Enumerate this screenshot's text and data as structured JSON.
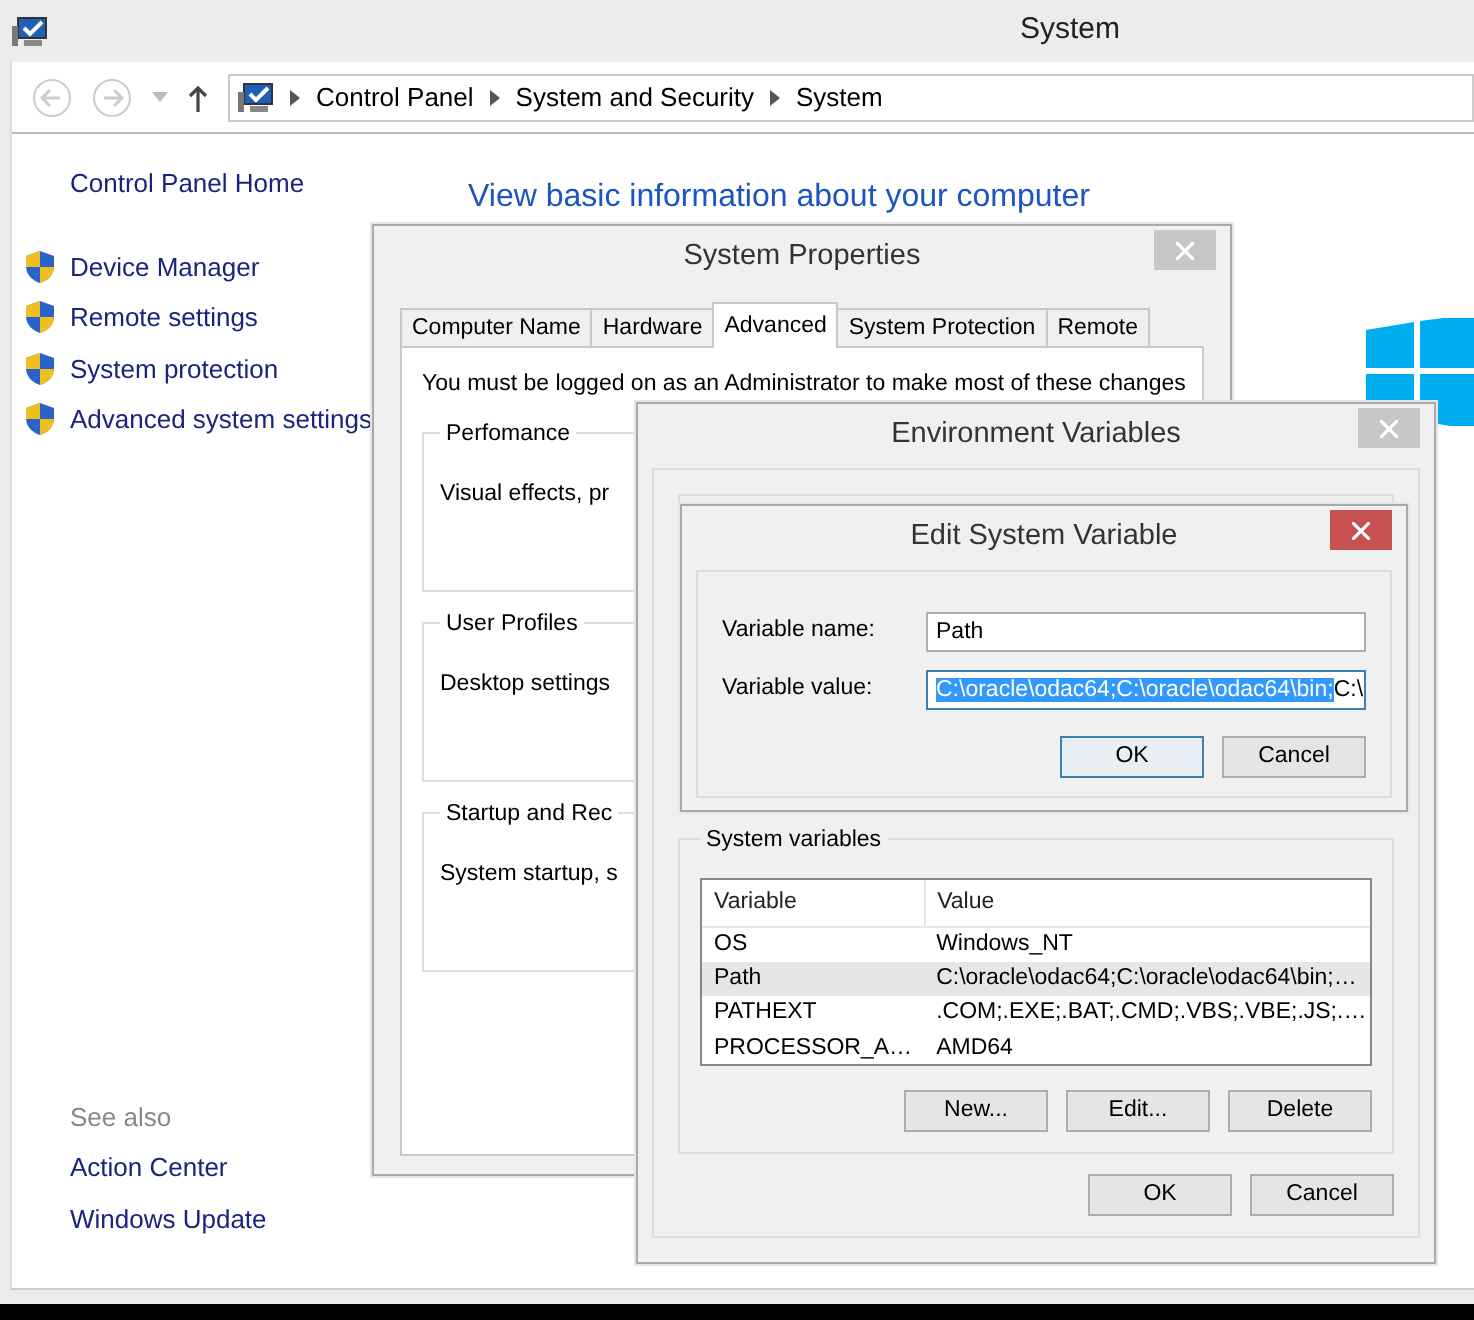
{
  "window": {
    "title": "System"
  },
  "address_bar": {
    "breadcrumbs": [
      "Control Panel",
      "System and Security",
      "System"
    ]
  },
  "sidebar": {
    "home": "Control Panel Home",
    "items": [
      "Device Manager",
      "Remote settings",
      "System protection",
      "Advanced system settings"
    ],
    "see_also": {
      "heading": "See also",
      "links": [
        "Action Center",
        "Windows Update"
      ]
    }
  },
  "main": {
    "heading": "View basic information about your computer"
  },
  "system_properties": {
    "title": "System Properties",
    "tabs": [
      {
        "label": "Computer Name",
        "selected": false
      },
      {
        "label": "Hardware",
        "selected": false
      },
      {
        "label": "Advanced",
        "selected": true
      },
      {
        "label": "System Protection",
        "selected": false
      },
      {
        "label": "Remote",
        "selected": false
      }
    ],
    "notice": "You must be logged on as an Administrator to make most of these changes",
    "groups": [
      {
        "title": "Perfomance",
        "text": "Visual effects, pr"
      },
      {
        "title": "User Profiles",
        "text": "Desktop settings"
      },
      {
        "title": "Startup and Rec",
        "text": "System startup, s"
      }
    ]
  },
  "environment_variables": {
    "title": "Environment Variables",
    "system_variables": {
      "title": "System variables",
      "columns": [
        "Variable",
        "Value"
      ],
      "rows": [
        {
          "variable": "OS",
          "value": "Windows_NT",
          "selected": false
        },
        {
          "variable": "Path",
          "value": "C:\\oracle\\odac64;C:\\oracle\\odac64\\bin;…",
          "selected": true
        },
        {
          "variable": "PATHEXT",
          "value": ".COM;.EXE;.BAT;.CMD;.VBS;.VBE;.JS;.…",
          "selected": false
        },
        {
          "variable": "PROCESSOR_A…",
          "value": "AMD64",
          "selected": false
        }
      ],
      "buttons": [
        "New...",
        "Edit...",
        "Delete"
      ]
    },
    "buttons": [
      {
        "label": "OK",
        "default": false
      },
      {
        "label": "Cancel",
        "default": false
      }
    ]
  },
  "edit_dialog": {
    "title": "Edit System Variable",
    "name_label": "Variable name:",
    "name_value": "Path",
    "value_label": "Variable value:",
    "value_selected": "C:\\oracle\\odac64;C:\\oracle\\odac64\\bin;",
    "value_rest": "C:\\",
    "buttons": [
      {
        "label": "OK",
        "default": true
      },
      {
        "label": "Cancel",
        "default": false
      }
    ]
  }
}
